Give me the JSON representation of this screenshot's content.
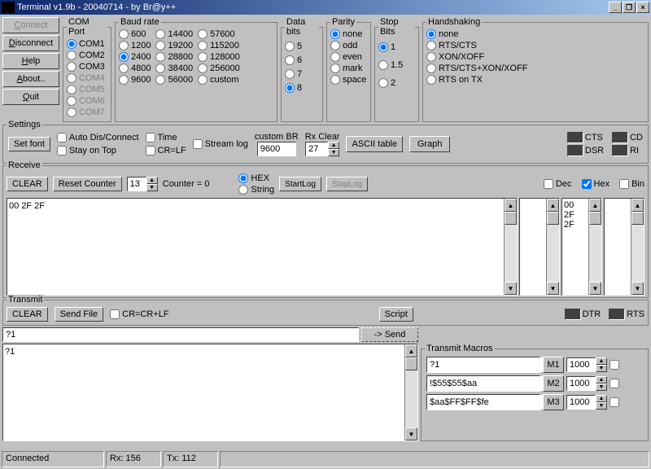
{
  "title": "Terminal v1.9b - 20040714 - by Br@y++",
  "btns": {
    "connect": "Connect",
    "disconnect": "Disconnect",
    "help": "Help",
    "about": "About..",
    "quit": "Quit"
  },
  "comport": {
    "label": "COM Port",
    "items": [
      "COM1",
      "COM2",
      "COM3",
      "COM4",
      "COM5",
      "COM6",
      "COM7"
    ]
  },
  "baud": {
    "label": "Baud rate",
    "c1": [
      "600",
      "1200",
      "2400",
      "4800",
      "9600"
    ],
    "c2": [
      "14400",
      "19200",
      "28800",
      "38400",
      "56000"
    ],
    "c3": [
      "57600",
      "115200",
      "128000",
      "256000",
      "custom"
    ]
  },
  "databits": {
    "label": "Data bits",
    "items": [
      "5",
      "6",
      "7",
      "8"
    ]
  },
  "parity": {
    "label": "Parity",
    "items": [
      "none",
      "odd",
      "even",
      "mark",
      "space"
    ]
  },
  "stopbits": {
    "label": "Stop Bits",
    "items": [
      "1",
      "1.5",
      "2"
    ]
  },
  "handshake": {
    "label": "Handshaking",
    "items": [
      "none",
      "RTS/CTS",
      "XON/XOFF",
      "RTS/CTS+XON/XOFF",
      "RTS on TX"
    ]
  },
  "settings": {
    "label": "Settings",
    "setfont": "Set font",
    "autodis": "Auto Dis/Connect",
    "stayontop": "Stay on Top",
    "time": "Time",
    "crlf": "CR=LF",
    "streamlog": "Stream log",
    "custombr": "custom BR",
    "custombr_val": "9600",
    "rxclear": "Rx Clear",
    "rxclear_val": "27",
    "ascii": "ASCII table",
    "graph": "Graph"
  },
  "ind": {
    "cts": "CTS",
    "cd": "CD",
    "dsr": "DSR",
    "ri": "RI",
    "dtr": "DTR",
    "rts": "RTS"
  },
  "receive": {
    "label": "Receive",
    "clear": "CLEAR",
    "reset": "Reset Counter",
    "spin": "13",
    "counter": "Counter = 0",
    "hex": "HEX",
    "string": "String",
    "startlog": "StartLog",
    "stoplog": "StopLog",
    "dec": "Dec",
    "hexchk": "Hex",
    "bin": "Bin",
    "data": "00 2F 2F",
    "col2": [
      "00",
      "2F",
      "2F"
    ]
  },
  "transmit": {
    "label": "Transmit",
    "clear": "CLEAR",
    "sendfile": "Send File",
    "crcrlf": "CR=CR+LF",
    "script": "Script",
    "input": "?1",
    "send": "-> Send",
    "area": "?1"
  },
  "macros": {
    "label": "Transmit Macros",
    "rows": [
      {
        "val": "?1",
        "btn": "M1",
        "num": "1000"
      },
      {
        "val": "!$55$55$aa",
        "btn": "M2",
        "num": "1000"
      },
      {
        "val": "$aa$FF$FF$fe",
        "btn": "M3",
        "num": "1000"
      }
    ]
  },
  "status": {
    "connected": "Connected",
    "rx": "Rx: 156",
    "tx": "Tx: 112"
  }
}
